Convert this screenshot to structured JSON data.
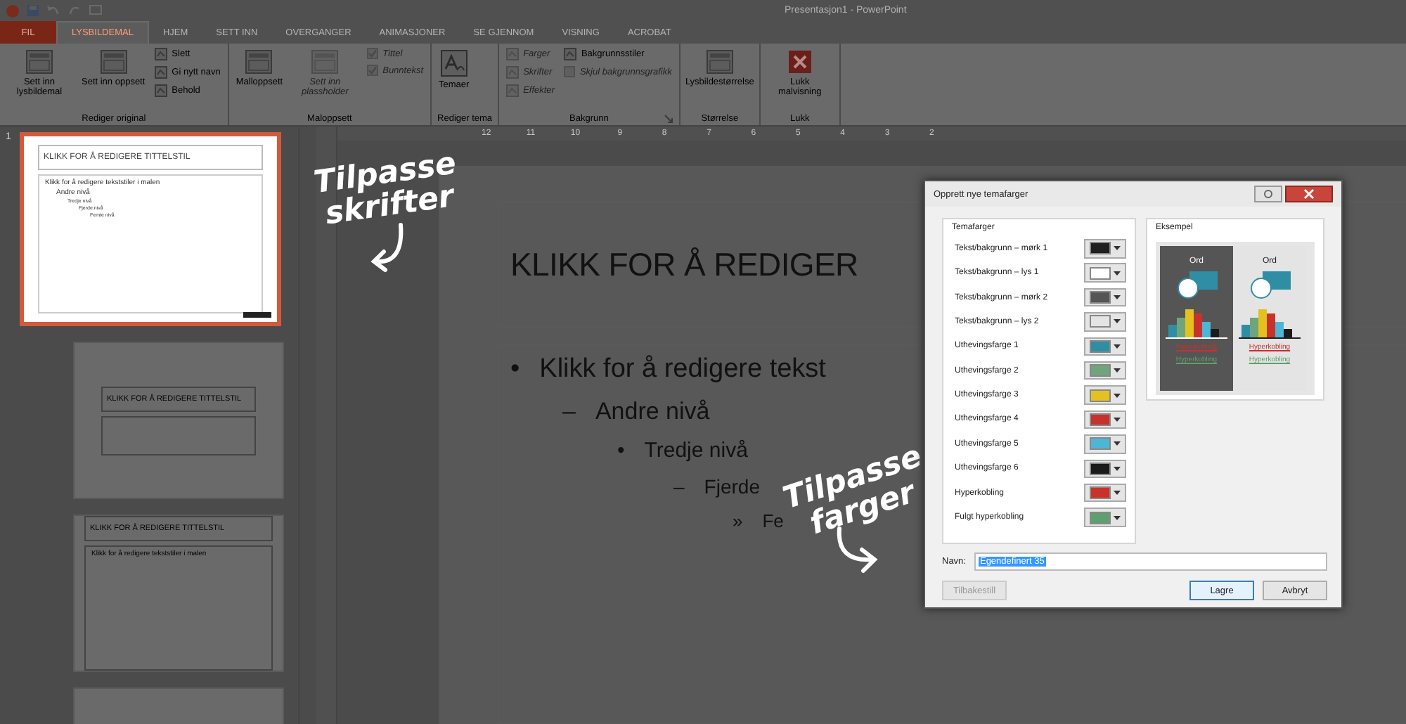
{
  "window": {
    "title": "Presentasjon1 - PowerPoint"
  },
  "tabs": [
    {
      "label": "FIL",
      "kind": "file",
      "selected": false
    },
    {
      "label": "LYSBILDEMAL",
      "kind": "tab",
      "selected": true
    },
    {
      "label": "HJEM",
      "kind": "tab",
      "selected": false
    },
    {
      "label": "SETT INN",
      "kind": "tab",
      "selected": false
    },
    {
      "label": "OVERGANGER",
      "kind": "tab",
      "selected": false
    },
    {
      "label": "ANIMASJONER",
      "kind": "tab",
      "selected": false
    },
    {
      "label": "SE GJENNOM",
      "kind": "tab",
      "selected": false
    },
    {
      "label": "VISNING",
      "kind": "tab",
      "selected": false
    },
    {
      "label": "ACROBAT",
      "kind": "tab",
      "selected": false
    }
  ],
  "ribbon": [
    {
      "label": "Rediger original",
      "columns": [
        [
          {
            "kind": "large",
            "label": "Sett inn lysbildemal",
            "disabled": false
          }
        ],
        [
          {
            "kind": "large",
            "label": "Sett inn oppsett",
            "disabled": false
          }
        ],
        [
          {
            "kind": "small",
            "label": "Slett",
            "disabled": false
          },
          {
            "kind": "small",
            "label": "Gi nytt navn",
            "disabled": false
          },
          {
            "kind": "small",
            "label": "Behold",
            "disabled": false
          }
        ]
      ]
    },
    {
      "label": "Maloppsett",
      "columns": [
        [
          {
            "kind": "large",
            "label": "Malloppsett",
            "disabled": false
          }
        ],
        [
          {
            "kind": "large",
            "label": "Sett inn plassholder",
            "disabled": true
          }
        ],
        [
          {
            "kind": "check",
            "label": "Tittel",
            "checked": true,
            "disabled": true
          },
          {
            "kind": "check",
            "label": "Bunntekst",
            "checked": true,
            "disabled": true
          }
        ]
      ]
    },
    {
      "label": "Rediger tema",
      "columns": [
        [
          {
            "kind": "theme",
            "label": "Temaer",
            "disabled": false
          }
        ]
      ]
    },
    {
      "label": "Bakgrunn",
      "columns": [
        [
          {
            "kind": "small",
            "label": "Farger",
            "disabled": true
          },
          {
            "kind": "small",
            "label": "Skrifter",
            "disabled": true
          },
          {
            "kind": "small",
            "label": "Effekter",
            "disabled": true
          }
        ],
        [
          {
            "kind": "small",
            "label": "Bakgrunnsstiler",
            "disabled": false
          },
          {
            "kind": "check",
            "label": "Skjul bakgrunnsgrafikk",
            "checked": false,
            "disabled": true
          }
        ]
      ]
    },
    {
      "label": "Størrelse",
      "columns": [
        [
          {
            "kind": "large",
            "label": "Lysbildestørrelse",
            "disabled": false
          }
        ]
      ]
    },
    {
      "label": "Lukk",
      "columns": [
        [
          {
            "kind": "close",
            "label": "Lukk malvisning",
            "disabled": false
          }
        ]
      ]
    }
  ],
  "ruler": [
    "12",
    "11",
    "10",
    "9",
    "8",
    "7",
    "6",
    "5",
    "4",
    "3",
    "2"
  ],
  "thumbnails": [
    {
      "kind": "master",
      "number": "1",
      "selected": true,
      "title": "KLIKK FOR Å REDIGERE TITTELSTIL",
      "lines": [
        "Klikk for å redigere tekststiler i malen",
        "Andre nivå",
        "Tredje nivå",
        "Fjerde nivå",
        "Femte nivå"
      ]
    },
    {
      "kind": "title",
      "selected": false,
      "title": "KLIKK FOR Å REDIGERE TITTELSTIL"
    },
    {
      "kind": "content",
      "selected": false,
      "title": "KLIKK FOR Å REDIGERE TITTELSTIL",
      "lines": [
        "Klikk for å redigere tekststiler i malen"
      ]
    },
    {
      "kind": "partial",
      "selected": false
    }
  ],
  "slide": {
    "title": "KLIKK FOR Å REDIGER",
    "levels": [
      {
        "marker": "•",
        "text": "Klikk for å redigere tekst"
      },
      {
        "marker": "–",
        "text": "Andre nivå"
      },
      {
        "marker": "•",
        "text": "Tredje nivå"
      },
      {
        "marker": "–",
        "text": "Fjerde"
      },
      {
        "marker": "»",
        "text": "Fe"
      }
    ]
  },
  "annotations": [
    {
      "text": "Tilpasse skrifter"
    },
    {
      "text": "Tilpasse farger"
    }
  ],
  "dialog": {
    "title": "Opprett nye temafarger",
    "group": "Temafarger",
    "example_label": "Eksempel",
    "colors": [
      {
        "label": "Tekst/bakgrunn – mørk 1",
        "color": "#1f1f1f"
      },
      {
        "label": "Tekst/bakgrunn – lys 1",
        "color": "#ffffff"
      },
      {
        "label": "Tekst/bakgrunn – mørk 2",
        "color": "#555555"
      },
      {
        "label": "Tekst/bakgrunn – lys 2",
        "color": "#e4e4e4"
      },
      {
        "label": "Uthevingsfarge 1",
        "color": "#2f8ea3"
      },
      {
        "label": "Uthevingsfarge 2",
        "color": "#6ea57c"
      },
      {
        "label": "Uthevingsfarge 3",
        "color": "#e3c21f"
      },
      {
        "label": "Uthevingsfarge 4",
        "color": "#c9312c"
      },
      {
        "label": "Uthevingsfarge 5",
        "color": "#4cb6d6"
      },
      {
        "label": "Uthevingsfarge 6",
        "color": "#1b1b1b"
      },
      {
        "label": "Hyperkobling",
        "color": "#c9312c"
      },
      {
        "label": "Fulgt hyperkobling",
        "color": "#5e9f6e"
      }
    ],
    "examples": [
      {
        "kind": "dark",
        "heading": "Ord",
        "link": "Hyperkobling",
        "followed": "Hyperkobling"
      },
      {
        "kind": "light",
        "heading": "Ord",
        "link": "Hyperkobling",
        "followed": "Hyperkobling"
      }
    ],
    "name_label": "Navn:",
    "name_value": "Egendefinert 35",
    "buttons": [
      {
        "label": "Tilbakestill",
        "disabled": true,
        "default": false
      },
      {
        "label": "Lagre",
        "disabled": false,
        "default": true
      },
      {
        "label": "Avbryt",
        "disabled": false,
        "default": false
      }
    ]
  }
}
